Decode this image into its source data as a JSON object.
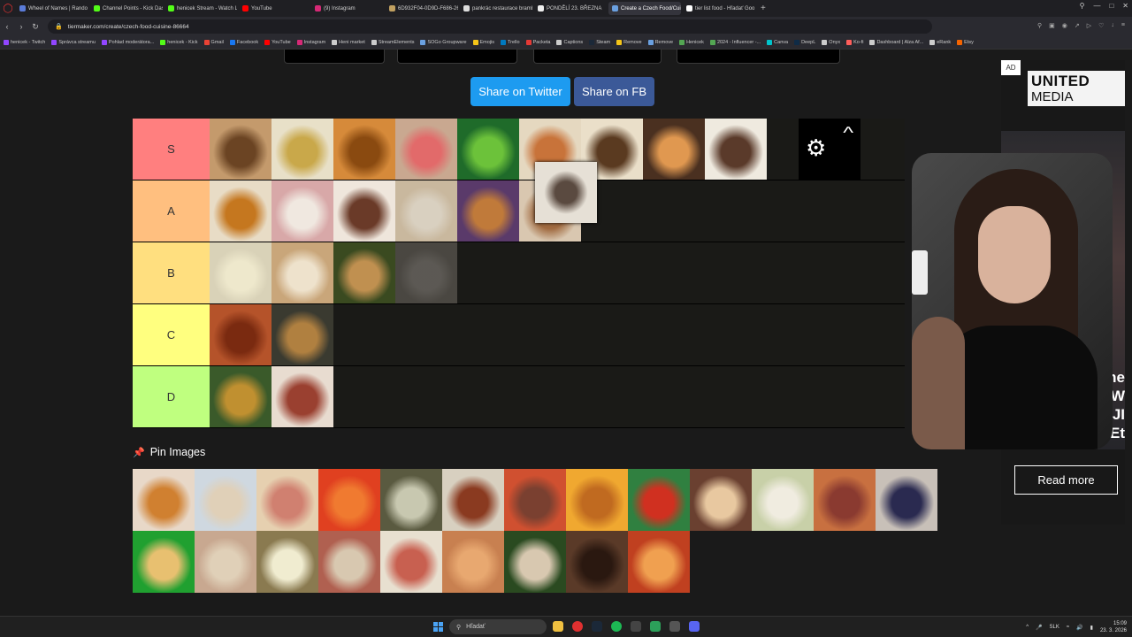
{
  "browser": {
    "tabs": [
      {
        "label": "Wheel of Names | Rando",
        "color": "#5a7bd8",
        "active": false
      },
      {
        "label": "Channel Points - Kick Das",
        "color": "#53fc18",
        "active": false
      },
      {
        "label": "henicek Stream - Watch Li",
        "color": "#53fc18",
        "active": false
      },
      {
        "label": "YouTube",
        "color": "#ff0000",
        "active": false
      },
      {
        "label": "(9) Instagram",
        "color": "#d62976",
        "active": false
      },
      {
        "label": "6D932F04-0D9D-F686-26",
        "color": "#c0a060",
        "active": false
      },
      {
        "label": "pankrác restaurace brambo",
        "color": "#dddddd",
        "active": false
      },
      {
        "label": "PONDĚLÍ 23. BŘEZNA",
        "color": "#eeeeee",
        "active": false
      },
      {
        "label": "Create a Czech Food/Cuis",
        "color": "#6aa0e0",
        "active": true
      },
      {
        "label": "tier list food - Hľadať Goo",
        "color": "#ffffff",
        "active": false
      }
    ],
    "new_tab": "+",
    "url": "tiermaker.com/create/czech-food-cuisine-86664",
    "bookmarks": [
      {
        "label": "henicek - Twitch",
        "color": "#9146ff"
      },
      {
        "label": "Správca streamu",
        "color": "#9146ff"
      },
      {
        "label": "Pohlad moderátora...",
        "color": "#9146ff"
      },
      {
        "label": "henicek - Kick",
        "color": "#53fc18"
      },
      {
        "label": "Gmail",
        "color": "#ea4335"
      },
      {
        "label": "Facebook",
        "color": "#1877f2"
      },
      {
        "label": "YouTube",
        "color": "#ff0000"
      },
      {
        "label": "Instagram",
        "color": "#d62976"
      },
      {
        "label": "Heni market",
        "color": "#cccccc"
      },
      {
        "label": "StreamElements",
        "color": "#cccccc"
      },
      {
        "label": "SOGo Groupware",
        "color": "#6aa0e0"
      },
      {
        "label": "Emojis",
        "color": "#f5c518"
      },
      {
        "label": "Trello",
        "color": "#0079bf"
      },
      {
        "label": "Packeta",
        "color": "#e53935"
      },
      {
        "label": "Captions",
        "color": "#cccccc"
      },
      {
        "label": "Steam",
        "color": "#1b2838"
      },
      {
        "label": "Remove",
        "color": "#f5c518"
      },
      {
        "label": "Remove",
        "color": "#6aa0e0"
      },
      {
        "label": "Henicek",
        "color": "#53a653"
      },
      {
        "label": "2024 - Influencer -...",
        "color": "#53a653"
      },
      {
        "label": "Canva",
        "color": "#00c4cc"
      },
      {
        "label": "DeepL",
        "color": "#0f2b46"
      },
      {
        "label": "Onyx",
        "color": "#cccccc"
      },
      {
        "label": "Ko-fi",
        "color": "#ff5e5b"
      },
      {
        "label": "Dashboard | Alza Af...",
        "color": "#cccccc"
      },
      {
        "label": "eRank",
        "color": "#cccccc"
      },
      {
        "label": "Etsy",
        "color": "#f56400"
      }
    ]
  },
  "page": {
    "share_twitter": "Share on Twitter",
    "share_fb": "Share on FB",
    "pin_images": "Pin Images",
    "tiers": [
      {
        "label": "S",
        "color": "#ff7f7f",
        "items": [
          {
            "name": "bábovka",
            "bg": "#c49a6c",
            "fg": "#6b4423"
          },
          {
            "name": "bramboracka",
            "bg": "#e8e0c8",
            "fg": "#c9a84a"
          },
          {
            "name": "langose",
            "bg": "#d68a3a",
            "fg": "#8a4a10"
          },
          {
            "name": "chlebicky",
            "bg": "#c9a890",
            "fg": "#e26a6a"
          },
          {
            "name": "hraskova-polevka",
            "bg": "#1f6b2a",
            "fg": "#6cc23a"
          },
          {
            "name": "rizek-salat",
            "bg": "#e5d8c0",
            "fg": "#c8733a"
          },
          {
            "name": "karbanatky",
            "bg": "#eadfc9",
            "fg": "#5a3a20"
          },
          {
            "name": "koblihy",
            "bg": "#4a3020",
            "fg": "#e09850"
          },
          {
            "name": "svickova-knedlik",
            "bg": "#efeadf",
            "fg": "#5a3a2a"
          }
        ]
      },
      {
        "label": "A",
        "color": "#ffbf7f",
        "items": [
          {
            "name": "bramboraky",
            "bg": "#e8dcc6",
            "fg": "#c5771f"
          },
          {
            "name": "kolace",
            "bg": "#d8a8a8",
            "fg": "#f0e8e0"
          },
          {
            "name": "svickova-omacka",
            "bg": "#efe6dc",
            "fg": "#6a3a28"
          },
          {
            "name": "houbova-omacka",
            "bg": "#c9b89e",
            "fg": "#d9d0c0"
          },
          {
            "name": "kachna-zeli",
            "bg": "#5a3a6a",
            "fg": "#c07a3a"
          },
          {
            "name": "uzeniny",
            "bg": "#d9c7b0",
            "fg": "#a06a40"
          }
        ]
      },
      {
        "label": "B",
        "color": "#ffdf7f",
        "items": [
          {
            "name": "knedle-omacka",
            "bg": "#d9d2b8",
            "fg": "#eee8cc"
          },
          {
            "name": "buchty",
            "bg": "#c9a67a",
            "fg": "#eee2cc"
          },
          {
            "name": "gulas-knedlik",
            "bg": "#3a4a20",
            "fg": "#c09050"
          },
          {
            "name": "rizoto",
            "bg": "#a39a90",
            "fg": "#d6cdc4",
            "faded": true
          }
        ]
      },
      {
        "label": "C",
        "color": "#ffff7f",
        "items": [
          {
            "name": "gulasova-polevka",
            "bg": "#b5532a",
            "fg": "#7a2a10"
          },
          {
            "name": "sekana",
            "bg": "#3a3a30",
            "fg": "#b08040"
          }
        ]
      },
      {
        "label": "D",
        "color": "#bfff7f",
        "items": [
          {
            "name": "coconova-polevka",
            "bg": "#3a5a2a",
            "fg": "#c09030"
          },
          {
            "name": "spenat-maso",
            "bg": "#e8dcd0",
            "fg": "#9a4030"
          }
        ]
      }
    ],
    "dragging_item": {
      "name": "makove-buchty",
      "bg": "#e6e0d6",
      "fg": "#5a4a40"
    },
    "pool": [
      {
        "name": "kure-omacka",
        "bg": "#e8d8c8",
        "fg": "#d08030"
      },
      {
        "name": "kyselo",
        "bg": "#cfd8e0",
        "fg": "#e0d0b8"
      },
      {
        "name": "pizza-chlebicek",
        "bg": "#e6d0b0",
        "fg": "#d08070"
      },
      {
        "name": "papriky",
        "bg": "#e04020",
        "fg": "#f07a30"
      },
      {
        "name": "bramborovy-salat",
        "bg": "#5a5a40",
        "fg": "#c8c8b0"
      },
      {
        "name": "klobasa",
        "bg": "#d8d0c0",
        "fg": "#8a3a20"
      },
      {
        "name": "cokoladovy-kolac",
        "bg": "#d05030",
        "fg": "#7a4030"
      },
      {
        "name": "ovocne-knedliky",
        "bg": "#f0a830",
        "fg": "#c06a20"
      },
      {
        "name": "rajska-polevka",
        "bg": "#308040",
        "fg": "#d03020"
      },
      {
        "name": "rizek-rize",
        "bg": "#6a4030",
        "fg": "#e8c8a0"
      },
      {
        "name": "kulajda",
        "bg": "#c8d0a8",
        "fg": "#f0ece0"
      },
      {
        "name": "kabanos-okurky",
        "bg": "#c87040",
        "fg": "#8a3a30"
      },
      {
        "name": "knedliky-boruvky",
        "bg": "#c8c0b8",
        "fg": "#2a2a50"
      },
      {
        "name": "hranolky",
        "bg": "#20a030",
        "fg": "#e8c070"
      },
      {
        "name": "svickova-porce",
        "bg": "#c8a890",
        "fg": "#e0d0b8"
      },
      {
        "name": "knedlik-krajeny",
        "bg": "#8a7a50",
        "fg": "#f0ecd0"
      },
      {
        "name": "nakladane",
        "bg": "#b06050",
        "fg": "#d8c8b0"
      },
      {
        "name": "maso-brambory",
        "bg": "#e8e0d0",
        "fg": "#c86050"
      },
      {
        "name": "vanocka",
        "bg": "#c88050",
        "fg": "#e8a870"
      },
      {
        "name": "vepro-knedlo",
        "bg": "#2a4a20",
        "fg": "#d8c8b0"
      },
      {
        "name": "makovy-zavin",
        "bg": "#5a3a28",
        "fg": "#2a1810"
      },
      {
        "name": "segedin",
        "bg": "#c04020",
        "fg": "#f0a050"
      }
    ]
  },
  "ad": {
    "badge": "AD",
    "logo_line1": "UNITED",
    "logo_line2": "MEDIA",
    "partial_text": "ne\nW\nJI\nEt",
    "read_more": "Read more"
  },
  "taskbar": {
    "search_label": "Hľadať",
    "lang": "SLK",
    "time": "15:09",
    "date": "23. 3. 2026"
  }
}
